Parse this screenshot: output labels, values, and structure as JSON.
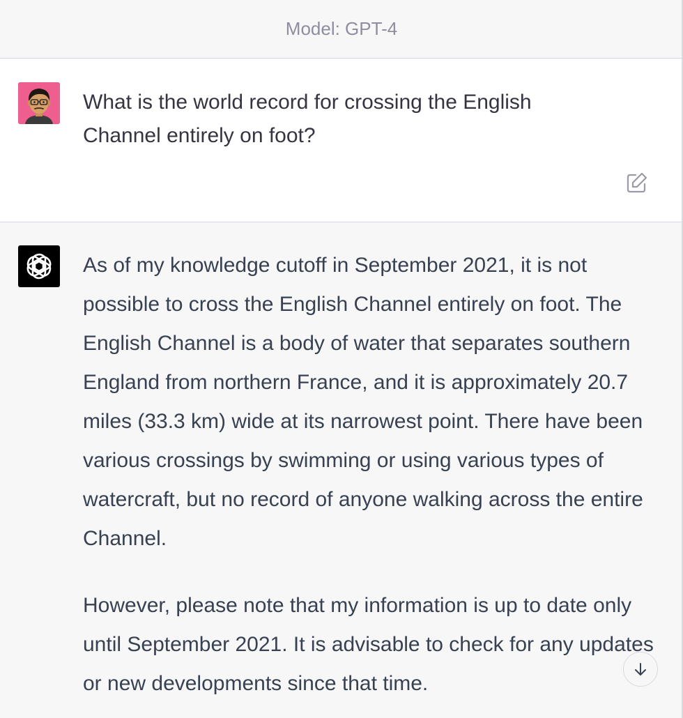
{
  "header": {
    "model_label": "Model: GPT-4"
  },
  "user_message": {
    "avatar_icon": "user-memoji-avatar",
    "avatar_bg": "#ee5f8f",
    "text": "What is the world record for crossing the English Channel entirely on foot?",
    "edit_icon": "edit-pencil-icon"
  },
  "assistant_message": {
    "avatar_icon": "openai-logo-icon",
    "avatar_bg": "#000000",
    "paragraphs": [
      "As of my knowledge cutoff in September 2021, it is not possible to cross the English Channel entirely on foot. The English Channel is a body of water that separates southern England from northern France, and it is approximately 20.7 miles (33.3 km) wide at its narrowest point. There have been various crossings by swimming or using various types of watercraft, but no record of anyone walking across the entire Channel.",
      "However, please note that my information is up to date only until September 2021. It is advisable to check for any updates or new developments since that time."
    ]
  },
  "controls": {
    "scroll_down_icon": "arrow-down-icon"
  }
}
